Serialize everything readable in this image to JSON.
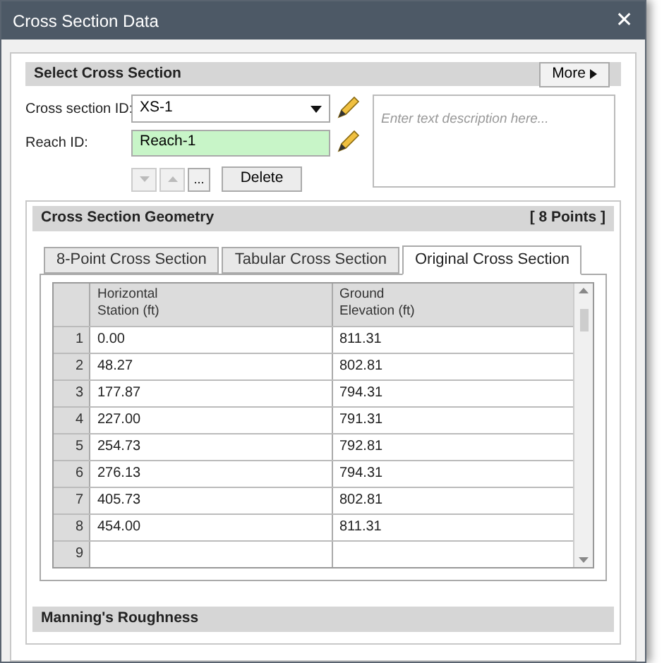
{
  "window": {
    "title": "Cross Section Data",
    "close": "✕"
  },
  "select_section": {
    "title": "Select Cross Section",
    "more_button": "More",
    "cross_section_label": "Cross section ID:",
    "cross_section_value": "XS-1",
    "reach_label": "Reach ID:",
    "reach_value": "Reach-1",
    "ellipsis_button": "...",
    "delete_button": "Delete",
    "description_placeholder": "Enter text description here..."
  },
  "geometry": {
    "title": "Cross Section Geometry",
    "count": "[ 8 Points ]",
    "tabs": [
      {
        "label": "8-Point Cross Section",
        "selected": false
      },
      {
        "label": "Tabular Cross Section",
        "selected": false
      },
      {
        "label": "Original Cross Section",
        "selected": true
      }
    ],
    "table": {
      "columns": [
        "Horizontal Station (ft)",
        "Ground Elevation (ft)"
      ],
      "rows": [
        {
          "number": "1",
          "cells": [
            "0.00",
            "811.31"
          ]
        },
        {
          "number": "2",
          "cells": [
            "48.27",
            "802.81"
          ]
        },
        {
          "number": "3",
          "cells": [
            "177.87",
            "794.31"
          ]
        },
        {
          "number": "4",
          "cells": [
            "227.00",
            "791.31"
          ]
        },
        {
          "number": "5",
          "cells": [
            "254.73",
            "792.81"
          ]
        },
        {
          "number": "6",
          "cells": [
            "276.13",
            "794.31"
          ]
        },
        {
          "number": "7",
          "cells": [
            "405.73",
            "802.81"
          ]
        },
        {
          "number": "8",
          "cells": [
            "454.00",
            "811.31"
          ]
        },
        {
          "number": "9",
          "cells": []
        }
      ]
    }
  },
  "roughness": {
    "title": "Manning's Roughness"
  }
}
